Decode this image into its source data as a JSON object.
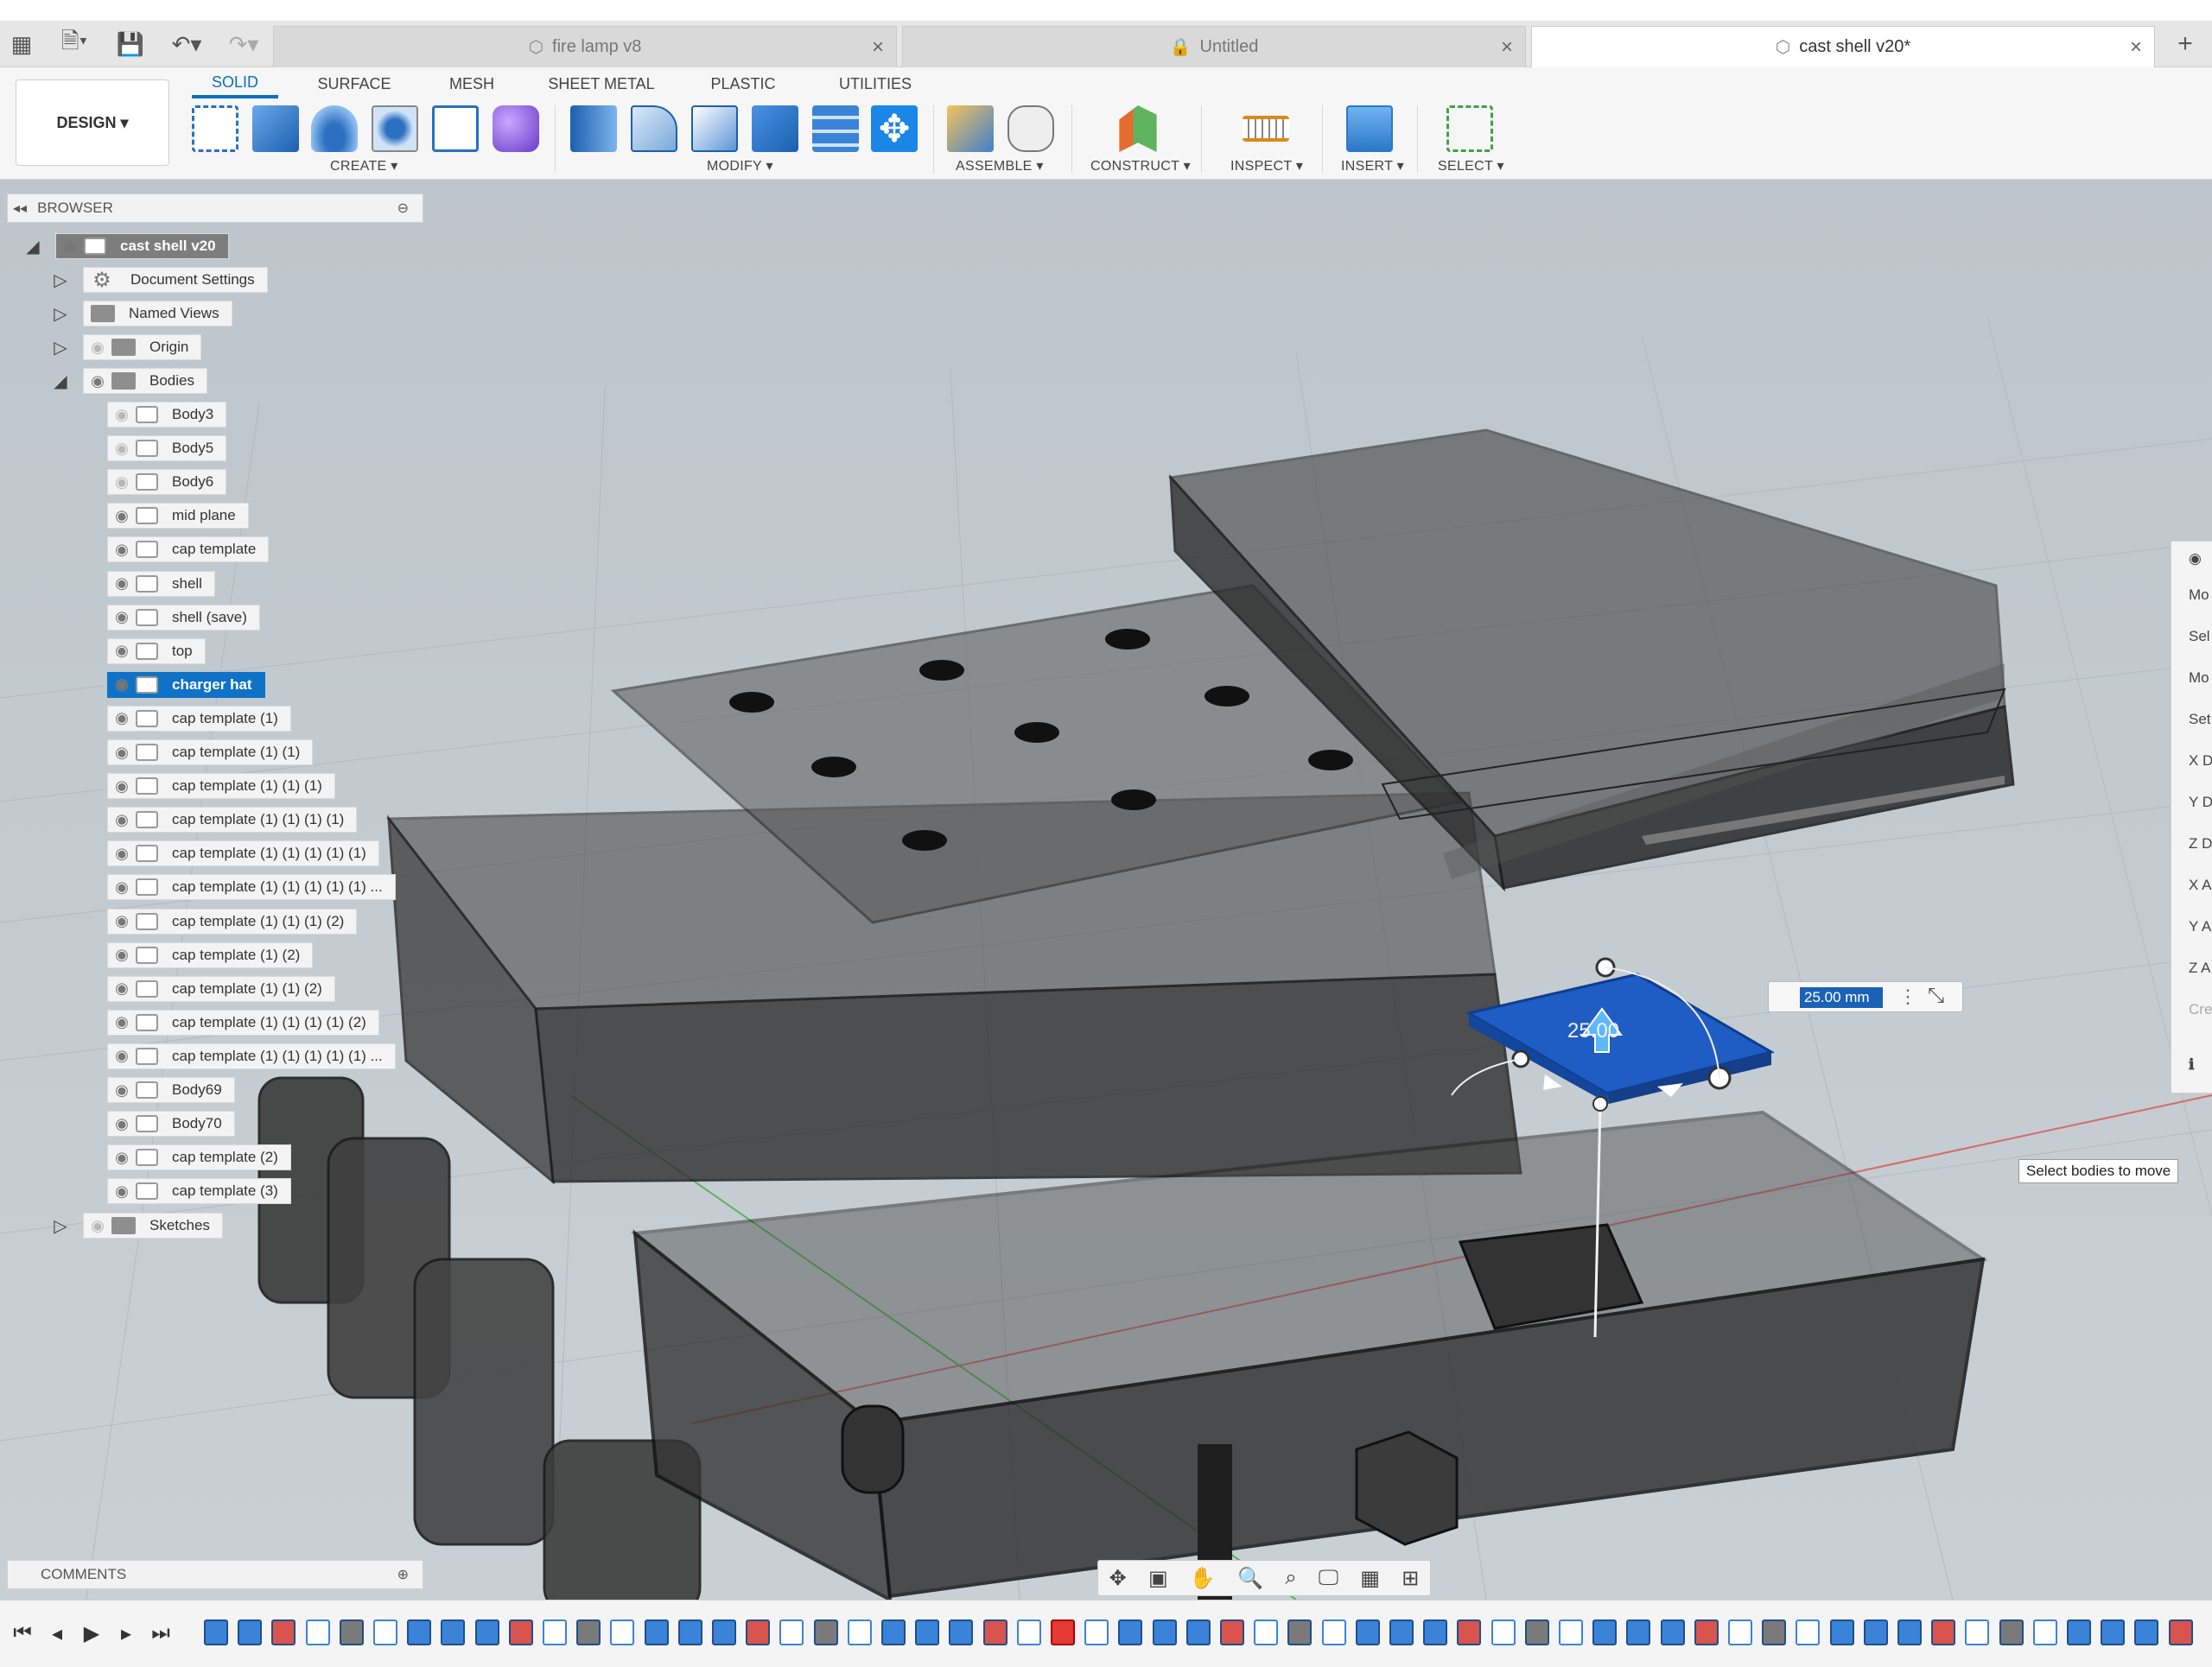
{
  "tabs": [
    {
      "label": "fire lamp v8",
      "active": false
    },
    {
      "label": "Untitled",
      "active": false
    },
    {
      "label": "cast shell v20*",
      "active": true
    }
  ],
  "toolbar": {
    "design_label": "DESIGN ▾",
    "workspace_tabs": [
      "SOLID",
      "SURFACE",
      "MESH",
      "SHEET METAL",
      "PLASTIC",
      "UTILITIES"
    ],
    "groups": [
      "CREATE ▾",
      "MODIFY ▾",
      "ASSEMBLE ▾",
      "CONSTRUCT ▾",
      "INSPECT ▾",
      "INSERT ▾",
      "SELECT ▾"
    ]
  },
  "browser": {
    "title": "BROWSER",
    "root": "cast shell v20",
    "folders": [
      "Document Settings",
      "Named Views",
      "Origin",
      "Bodies"
    ],
    "bodies": [
      "Body3",
      "Body5",
      "Body6",
      "mid plane",
      "cap template",
      "shell",
      "shell (save)",
      "top",
      "charger hat",
      "cap template (1)",
      "cap template (1) (1)",
      "cap template (1) (1) (1)",
      "cap template (1) (1) (1) (1)",
      "cap template (1) (1) (1) (1) (1)",
      "cap template (1) (1) (1) (1) (1) ...",
      "cap template (1) (1) (1) (2)",
      "cap template (1) (2)",
      "cap template (1) (1) (2)",
      "cap template (1) (1) (1) (1) (2)",
      "cap template (1) (1) (1) (1) (1) ...",
      "Body69",
      "Body70",
      "cap template (2)",
      "cap template (3)"
    ],
    "sketches": "Sketches",
    "selected": "charger hat"
  },
  "comments": {
    "title": "COMMENTS"
  },
  "dimension": {
    "value": "25.00 mm",
    "label": "25.00"
  },
  "tooltip": "Select bodies to move",
  "right_panel": [
    "Mo",
    "Sel",
    "Mo",
    "Set",
    "X D",
    "Y D",
    "Z D",
    "X A",
    "Y A",
    "Z A",
    "Cre"
  ],
  "colors": {
    "accent": "#0b6fc0",
    "selection": "#0f72c7",
    "viewport": "#c3cbd0"
  }
}
